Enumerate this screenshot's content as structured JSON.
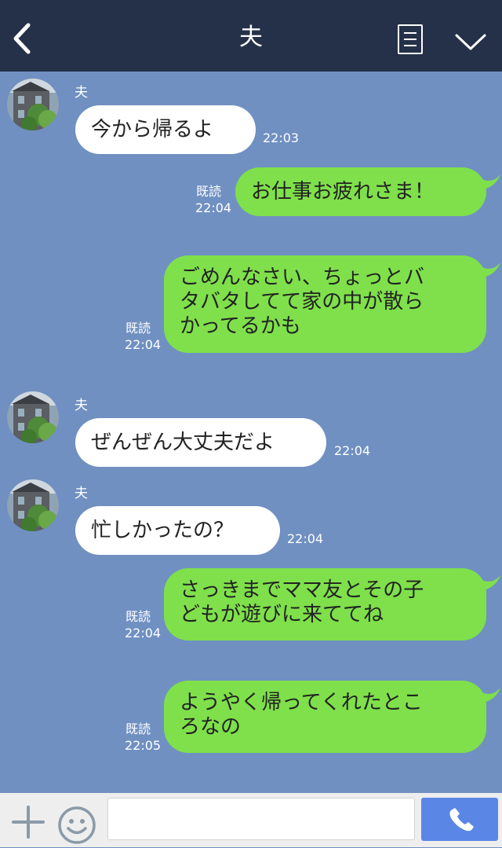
{
  "header": {
    "title": "夫",
    "back_icon": "chevron-left-icon",
    "menu_icon": "list-icon",
    "collapse_icon": "chevron-down-icon",
    "background": "#253049"
  },
  "chat": {
    "background": "#7090c2",
    "incoming_bubble_color": "#ffffff",
    "outgoing_bubble_color": "#7fe04b",
    "messages": [
      {
        "direction": "incoming",
        "sender": "夫",
        "text": "今から帰るよ",
        "time": "22:03"
      },
      {
        "direction": "outgoing",
        "read": "既読",
        "text": "お仕事お疲れさま！",
        "time": "22:04"
      },
      {
        "direction": "outgoing",
        "read": "既読",
        "lines": [
          "ごめんなさい、ちょっとバ",
          "タバタしてて家の中が散ら",
          "かってるかも"
        ],
        "time": "22:04"
      },
      {
        "direction": "incoming",
        "sender": "夫",
        "text": "ぜんぜん大丈夫だよ",
        "time": "22:04"
      },
      {
        "direction": "incoming",
        "sender": "夫",
        "text": "忙しかったの？",
        "time": "22:04"
      },
      {
        "direction": "outgoing",
        "read": "既読",
        "lines": [
          "さっきまでママ友とその子",
          "どもが遊びに来ててね"
        ],
        "time": "22:04"
      },
      {
        "direction": "outgoing",
        "read": "既読",
        "lines": [
          "ようやく帰ってくれたとこ",
          "ろなの"
        ],
        "time": "22:05"
      }
    ]
  },
  "input_bar": {
    "plus_icon": "plus-icon",
    "emoji_icon": "smiley-icon",
    "input_value": "",
    "call_icon": "phone-icon",
    "call_color": "#5a86e6"
  }
}
